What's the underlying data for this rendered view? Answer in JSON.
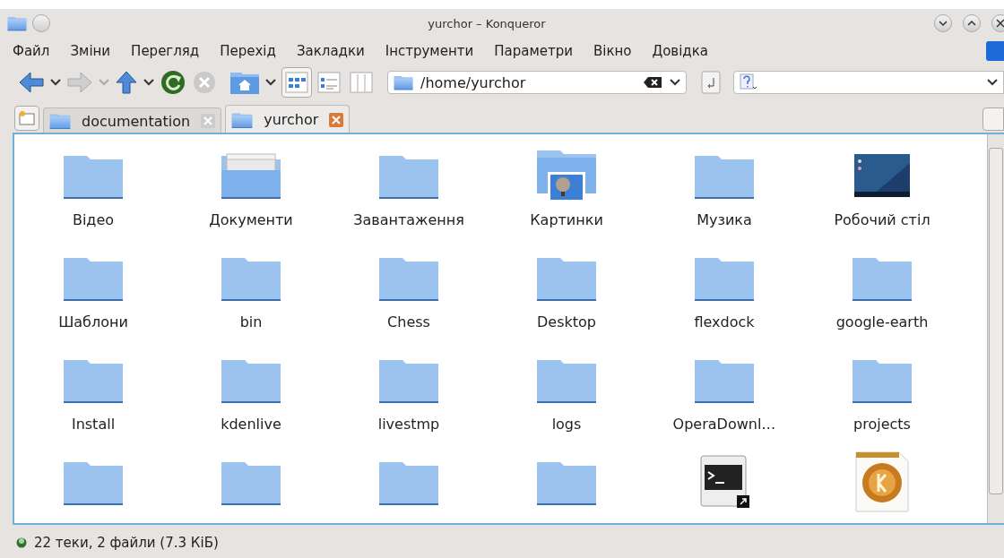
{
  "window": {
    "title": "yurchor – Konqueror"
  },
  "menu": [
    "Файл",
    "Зміни",
    "Перегляд",
    "Перехід",
    "Закладки",
    "Інструменти",
    "Параметри",
    "Вікно",
    "Довідка"
  ],
  "view_modes": [
    {
      "kind": "icons",
      "selected": true
    },
    {
      "kind": "details",
      "selected": false
    },
    {
      "kind": "columns",
      "selected": false
    }
  ],
  "location": {
    "value": "/home/yurchor"
  },
  "tabs": [
    {
      "label": "documentation",
      "selected": false
    },
    {
      "label": "yurchor",
      "selected": true
    }
  ],
  "files": [
    {
      "name": "Відео",
      "kind": "folder"
    },
    {
      "name": "Документи",
      "kind": "documents"
    },
    {
      "name": "Завантаження",
      "kind": "folder"
    },
    {
      "name": "Картинки",
      "kind": "pictures"
    },
    {
      "name": "Музика",
      "kind": "folder"
    },
    {
      "name": "Робочий стіл",
      "kind": "desktop"
    },
    {
      "name": "Шаблони",
      "kind": "folder"
    },
    {
      "name": "bin",
      "kind": "folder"
    },
    {
      "name": "Chess",
      "kind": "folder"
    },
    {
      "name": "Desktop",
      "kind": "folder"
    },
    {
      "name": "flexdock",
      "kind": "folder"
    },
    {
      "name": "google-earth",
      "kind": "folder"
    },
    {
      "name": "Install",
      "kind": "folder"
    },
    {
      "name": "kdenlive",
      "kind": "folder"
    },
    {
      "name": "livestmp",
      "kind": "folder"
    },
    {
      "name": "logs",
      "kind": "folder"
    },
    {
      "name": "OperaDownl…",
      "kind": "folder"
    },
    {
      "name": "projects",
      "kind": "folder"
    },
    {
      "kind": "folder"
    },
    {
      "kind": "folder"
    },
    {
      "kind": "folder"
    },
    {
      "kind": "folder"
    },
    {
      "kind": "terminal"
    },
    {
      "kind": "document"
    }
  ],
  "status_bar": {
    "text": "22 теки, 2 файли (7.3 КіБ)"
  }
}
